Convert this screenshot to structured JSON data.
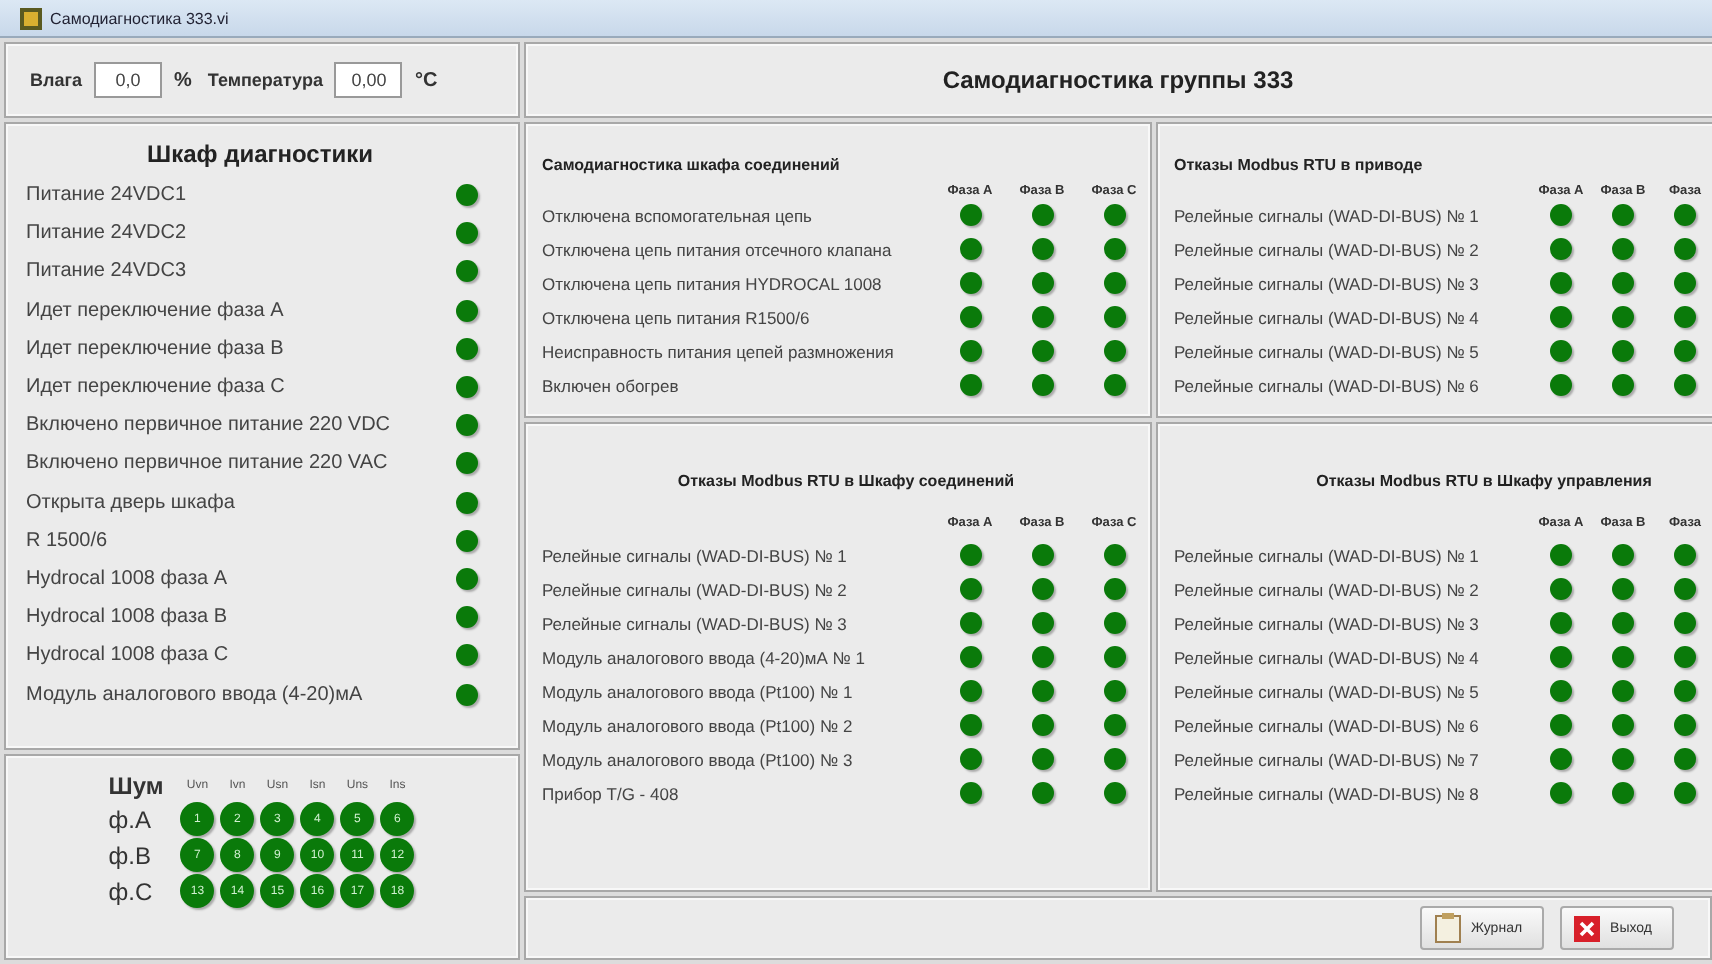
{
  "window": {
    "title": "Самодиагностика 333.vi"
  },
  "sensors": [
    {
      "label": "Влага",
      "value": "0,0",
      "unit": "%"
    },
    {
      "label": "Температура",
      "value": "0,00",
      "unit": "°C"
    }
  ],
  "header": "Самодиагностика группы 333",
  "cabinet": {
    "title": "Шкаф диагностики",
    "items": [
      {
        "label": "Питание 24VDC1",
        "on": true
      },
      {
        "label": "Питание 24VDC2",
        "on": true
      },
      {
        "label": "Питание 24VDC3",
        "on": true
      },
      {
        "label": "Идет переключение фаза А",
        "on": true
      },
      {
        "label": "Идет переключение фаза В",
        "on": true
      },
      {
        "label": "Идет переключение фаза С",
        "on": true
      },
      {
        "label": "Включено первичное питание 220 VDC",
        "on": true
      },
      {
        "label": "Включено первичное питание 220 VAC",
        "on": true
      },
      {
        "label": "Открыта дверь шкафа",
        "on": true
      },
      {
        "label": "R 1500/6",
        "on": true
      },
      {
        "label": "Hydrocal 1008 фаза А",
        "on": true
      },
      {
        "label": "Hydrocal 1008 фаза В",
        "on": true
      },
      {
        "label": "Hydrocal 1008 фаза С",
        "on": true
      },
      {
        "label": "Модуль аналогового ввода (4-20)мА",
        "on": true
      }
    ]
  },
  "noise": {
    "title": "Шум",
    "columns": [
      "Uvn",
      "Ivn",
      "Usn",
      "Isn",
      "Uns",
      "Ins"
    ],
    "rows": [
      {
        "label": "ф.А",
        "leds": [
          {
            "text": "1",
            "on": true
          },
          {
            "text": "2",
            "on": true
          },
          {
            "text": "3",
            "on": true
          },
          {
            "text": "4",
            "on": true
          },
          {
            "text": "5",
            "on": true
          },
          {
            "text": "6",
            "on": true
          }
        ]
      },
      {
        "label": "ф.В",
        "leds": [
          {
            "text": "7",
            "on": true
          },
          {
            "text": "8",
            "on": true
          },
          {
            "text": "9",
            "on": true
          },
          {
            "text": "10",
            "on": true
          },
          {
            "text": "11",
            "on": true
          },
          {
            "text": "12",
            "on": true
          }
        ]
      },
      {
        "label": "ф.С",
        "leds": [
          {
            "text": "13",
            "on": true
          },
          {
            "text": "14",
            "on": true
          },
          {
            "text": "15",
            "on": true
          },
          {
            "text": "16",
            "on": true
          },
          {
            "text": "17",
            "on": true
          },
          {
            "text": "18",
            "on": true
          }
        ]
      }
    ]
  },
  "panels": [
    {
      "title": "Самодиагностика шкафа соединений",
      "phases": [
        "Фаза А",
        "Фаза В",
        "Фаза С"
      ],
      "rows": [
        {
          "label": "Отключена вспомогательная цепь",
          "on": [
            true,
            true,
            true
          ]
        },
        {
          "label": "Отключена цепь питания отсечного клапана",
          "on": [
            true,
            true,
            true
          ]
        },
        {
          "label": "Отключена цепь питания HYDROCAL 1008",
          "on": [
            true,
            true,
            true
          ]
        },
        {
          "label": "Отключена цепь питания R1500/6",
          "on": [
            true,
            true,
            true
          ]
        },
        {
          "label": "Неисправность питания цепей размножения",
          "on": [
            true,
            true,
            true
          ]
        },
        {
          "label": "Включен обогрев",
          "on": [
            true,
            true,
            true
          ]
        }
      ]
    },
    {
      "title": "Отказы Modbus RTU в приводе",
      "phases": [
        "Фаза А",
        "Фаза В",
        "Фаза"
      ],
      "rows": [
        {
          "label": "Релейные сигналы (WAD-DI-BUS) № 1",
          "on": [
            true,
            true,
            true
          ]
        },
        {
          "label": "Релейные сигналы (WAD-DI-BUS) № 2",
          "on": [
            true,
            true,
            true
          ]
        },
        {
          "label": "Релейные сигналы (WAD-DI-BUS) № 3",
          "on": [
            true,
            true,
            true
          ]
        },
        {
          "label": "Релейные сигналы (WAD-DI-BUS) № 4",
          "on": [
            true,
            true,
            true
          ]
        },
        {
          "label": "Релейные сигналы (WAD-DI-BUS) № 5",
          "on": [
            true,
            true,
            true
          ]
        },
        {
          "label": "Релейные сигналы (WAD-DI-BUS) № 6",
          "on": [
            true,
            true,
            true
          ]
        }
      ]
    },
    {
      "title": "Отказы Modbus RTU в Шкафу соединений",
      "phases": [
        "Фаза А",
        "Фаза В",
        "Фаза С"
      ],
      "rows": [
        {
          "label": "Релейные сигналы (WAD-DI-BUS) № 1",
          "on": [
            true,
            true,
            true
          ]
        },
        {
          "label": "Релейные сигналы (WAD-DI-BUS) № 2",
          "on": [
            true,
            true,
            true
          ]
        },
        {
          "label": "Релейные сигналы (WAD-DI-BUS) № 3",
          "on": [
            true,
            true,
            true
          ]
        },
        {
          "label": "Модуль аналогового ввода (4-20)мА № 1",
          "on": [
            true,
            true,
            true
          ]
        },
        {
          "label": "Модуль аналогового ввода (Pt100) № 1",
          "on": [
            true,
            true,
            true
          ]
        },
        {
          "label": "Модуль аналогового ввода (Pt100) № 2",
          "on": [
            true,
            true,
            true
          ]
        },
        {
          "label": "Модуль аналогового ввода (Pt100) № 3",
          "on": [
            true,
            true,
            true
          ]
        },
        {
          "label": "Прибор T/G - 408",
          "on": [
            true,
            true,
            true
          ]
        }
      ]
    },
    {
      "title": "Отказы Modbus RTU в Шкафу управления",
      "phases": [
        "Фаза А",
        "Фаза В",
        "Фаза"
      ],
      "rows": [
        {
          "label": "Релейные сигналы (WAD-DI-BUS) № 1",
          "on": [
            true,
            true,
            true
          ]
        },
        {
          "label": "Релейные сигналы (WAD-DI-BUS) № 2",
          "on": [
            true,
            true,
            true
          ]
        },
        {
          "label": "Релейные сигналы (WAD-DI-BUS) № 3",
          "on": [
            true,
            true,
            true
          ]
        },
        {
          "label": "Релейные сигналы (WAD-DI-BUS) № 4",
          "on": [
            true,
            true,
            true
          ]
        },
        {
          "label": "Релейные сигналы (WAD-DI-BUS) № 5",
          "on": [
            true,
            true,
            true
          ]
        },
        {
          "label": "Релейные сигналы (WAD-DI-BUS) № 6",
          "on": [
            true,
            true,
            true
          ]
        },
        {
          "label": "Релейные сигналы (WAD-DI-BUS) № 7",
          "on": [
            true,
            true,
            true
          ]
        },
        {
          "label": "Релейные сигналы (WAD-DI-BUS) № 8",
          "on": [
            true,
            true,
            true
          ]
        }
      ]
    }
  ],
  "buttons": [
    {
      "kind": "log",
      "label": "Журнал"
    },
    {
      "kind": "exit",
      "label": "Выход"
    }
  ]
}
